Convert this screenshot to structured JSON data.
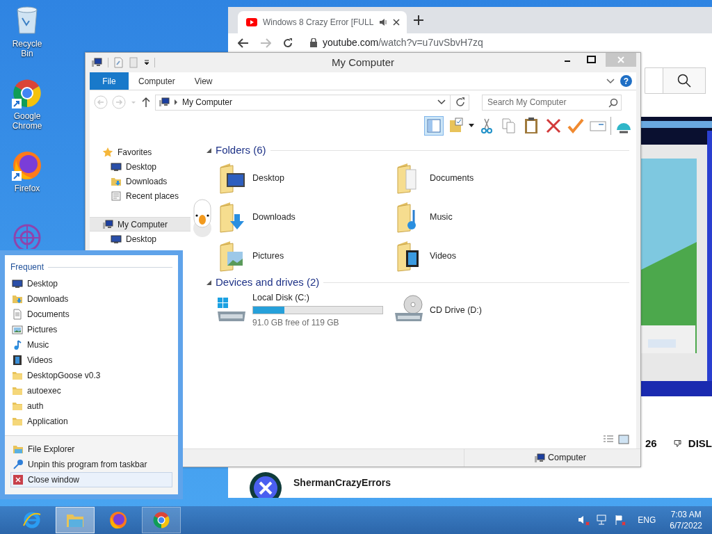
{
  "desktop_icons": [
    {
      "label": "Recycle Bin",
      "kind": "recycle"
    },
    {
      "label": "Google Chrome",
      "kind": "chrome"
    },
    {
      "label": "Firefox",
      "kind": "firefox"
    }
  ],
  "browser": {
    "tab": {
      "title": "Windows 8 Crazy Error [FULL"
    },
    "address": {
      "host": "youtube.com",
      "path": "/watch?v=u7uvSbvH7zq"
    },
    "like_count": "26",
    "dislike_label": "DISL",
    "channel": {
      "name": "ShermanCrazyErrors"
    }
  },
  "explorer": {
    "title": "My Computer",
    "ribbon_tabs": [
      {
        "label": "File",
        "kind": "file"
      },
      {
        "label": "Computer",
        "kind": "tab"
      },
      {
        "label": "View",
        "kind": "tab"
      }
    ],
    "help_label": "?",
    "address": "My Computer",
    "search": {
      "placeholder": "Search My Computer"
    },
    "toolbar": [
      {
        "kind": "pane",
        "on": true
      },
      {
        "kind": "folder",
        "on": false
      },
      {
        "kind": "cut",
        "on": false
      },
      {
        "kind": "copy",
        "on": false
      },
      {
        "kind": "paste",
        "on": false
      },
      {
        "kind": "delete",
        "on": false
      },
      {
        "kind": "check",
        "on": false
      },
      {
        "kind": "mail",
        "on": false
      },
      {
        "kind": "shell",
        "on": false
      }
    ],
    "nav": [
      {
        "label": "Favorites",
        "kind": "star",
        "selected": false,
        "children": [
          {
            "label": "Desktop",
            "kind": "desktop",
            "selected": false
          },
          {
            "label": "Downloads",
            "kind": "downloads",
            "selected": false
          },
          {
            "label": "Recent places",
            "kind": "recent",
            "selected": false
          }
        ]
      },
      {
        "label": "My Computer",
        "kind": "computer",
        "selected": true,
        "children": [
          {
            "label": "Desktop",
            "kind": "desktop",
            "selected": false
          }
        ]
      }
    ],
    "groups": [
      {
        "title": "Folders (6)",
        "items": [
          {
            "label": "Desktop",
            "kind": "desktop"
          },
          {
            "label": "Documents",
            "kind": "documents"
          },
          {
            "label": "Downloads",
            "kind": "downloads"
          },
          {
            "label": "Music",
            "kind": "music"
          },
          {
            "label": "Pictures",
            "kind": "pictures"
          },
          {
            "label": "Videos",
            "kind": "videos"
          }
        ]
      },
      {
        "title": "Devices and drives (2)",
        "items": [
          {
            "label": "Local Disk (C:)",
            "kind": "disk",
            "level": 0.24,
            "detail": "91.0 GB free of 119 GB"
          },
          {
            "label": "CD Drive (D:)",
            "kind": "cd"
          }
        ]
      }
    ],
    "status": "Computer"
  },
  "jump_list": {
    "header": "Frequent",
    "items": [
      {
        "label": "Desktop",
        "kind": "desktop"
      },
      {
        "label": "Downloads",
        "kind": "downloads"
      },
      {
        "label": "Documents",
        "kind": "documents"
      },
      {
        "label": "Pictures",
        "kind": "pictures"
      },
      {
        "label": "Music",
        "kind": "music"
      },
      {
        "label": "Videos",
        "kind": "videos"
      },
      {
        "label": "DesktopGoose v0.3",
        "kind": "folder"
      },
      {
        "label": "autoexec",
        "kind": "folder"
      },
      {
        "label": "auth",
        "kind": "folder"
      },
      {
        "label": "Application",
        "kind": "folder"
      }
    ],
    "tasks": [
      {
        "label": "File Explorer",
        "kind": "explorer",
        "selected": false
      },
      {
        "label": "Unpin this program from taskbar",
        "kind": "unpin",
        "selected": false
      },
      {
        "label": "Close window",
        "kind": "close",
        "selected": true
      }
    ]
  },
  "taskbar": {
    "apps": [
      {
        "kind": "ie",
        "running": false,
        "selected": false
      },
      {
        "kind": "explorer",
        "running": true,
        "selected": true
      },
      {
        "kind": "firefox",
        "running": false,
        "selected": false
      },
      {
        "kind": "chrome",
        "running": true,
        "selected": false
      }
    ],
    "language": "ENG",
    "time": "7:03 AM",
    "date": "6/7/2022"
  }
}
